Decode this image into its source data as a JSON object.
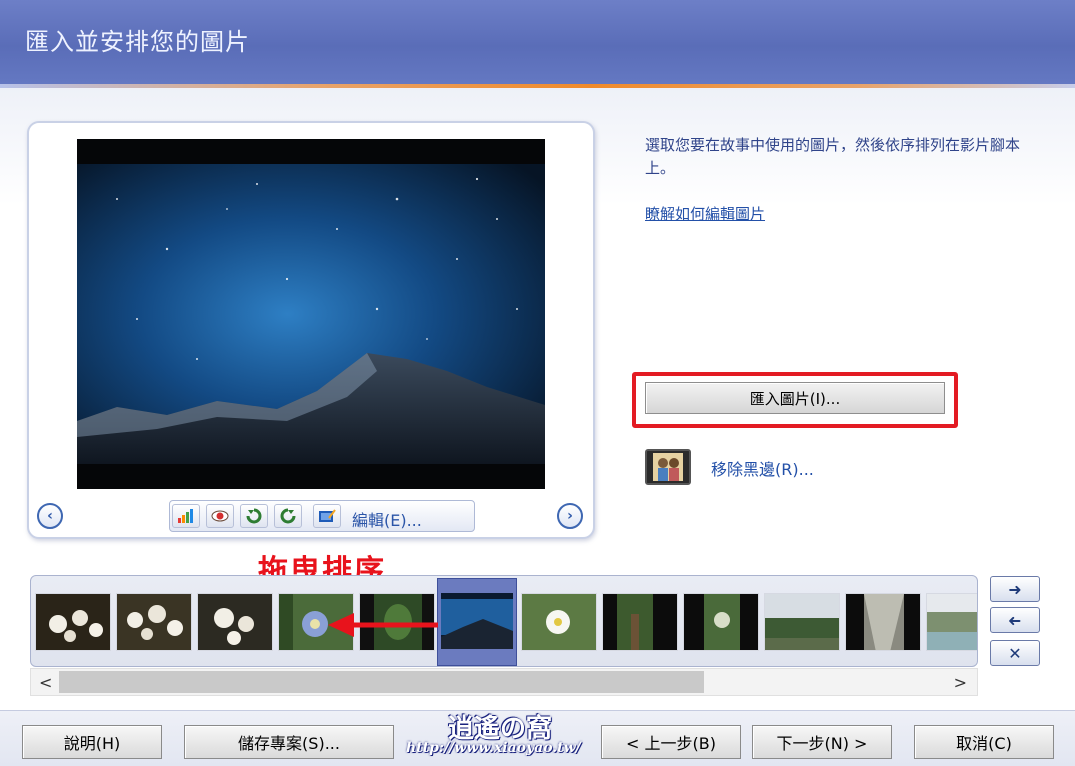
{
  "header": {
    "title": "匯入並安排您的圖片"
  },
  "preview": {
    "prev_icon": "chevron-left-icon",
    "next_icon": "chevron-right-icon",
    "tools": [
      "auto-adjust-icon",
      "red-eye-icon",
      "rotate-left-icon",
      "rotate-right-icon",
      "edit-icon"
    ],
    "edit_label": "編輯(E)..."
  },
  "instructions": {
    "text": "選取您要在故事中使用的圖片，然後依序排列在影片腳本上。",
    "learn_link": "瞭解如何編輯圖片"
  },
  "import_button": {
    "label": "匯入圖片(I)..."
  },
  "remove_border": {
    "label": "移除黑邊(R)..."
  },
  "annotation": {
    "text": "拖曳排序"
  },
  "filmstrip": {
    "thumbnails": [
      "flowers-1",
      "flowers-2",
      "flowers-3",
      "blue-flower",
      "leaves",
      "night-sky-mountain",
      "white-flower",
      "forest-path",
      "plant-portrait",
      "forest-landscape",
      "corridor",
      "lake-view"
    ],
    "selected_index": 5,
    "side_buttons": [
      "arrow-right-icon",
      "arrow-left-icon",
      "close-icon"
    ]
  },
  "scrollbar": {
    "left": "<",
    "right": ">"
  },
  "bottom_buttons": {
    "help": "說明(H)",
    "save_project": "儲存專案(S)...",
    "back": "< 上一步(B)",
    "next": "下一步(N) >",
    "cancel": "取消(C)"
  },
  "watermark": {
    "logo_text": "逍遙の窩",
    "url_text": "http://www.xiaoyao.tw/"
  },
  "colors": {
    "header": "#6276c0",
    "accent_orange": "#f08a2a",
    "highlight_red": "#e31b23",
    "link_blue": "#2350a8"
  }
}
